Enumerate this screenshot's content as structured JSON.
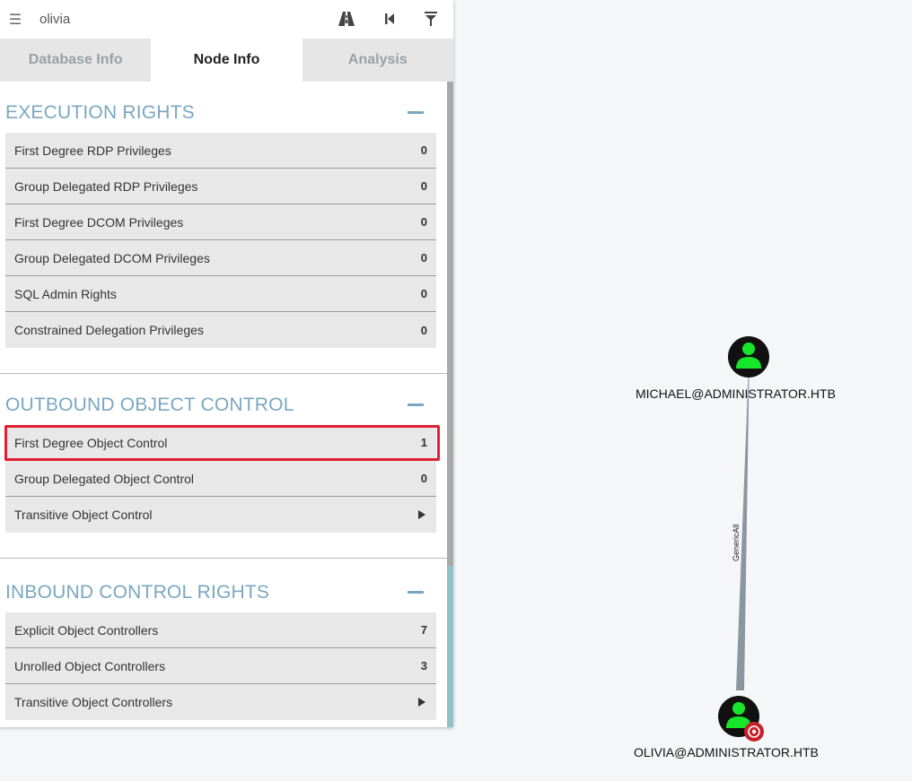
{
  "search": {
    "value": "olivia"
  },
  "toolbar_icons": [
    "pathfinding-icon",
    "back-icon",
    "filter-icon"
  ],
  "tabs": [
    {
      "label": "Database Info",
      "active": false
    },
    {
      "label": "Node Info",
      "active": true
    },
    {
      "label": "Analysis",
      "active": false
    }
  ],
  "sections": [
    {
      "title": "EXECUTION RIGHTS",
      "rows": [
        {
          "label": "First Degree RDP Privileges",
          "value": "0"
        },
        {
          "label": "Group Delegated RDP Privileges",
          "value": "0"
        },
        {
          "label": "First Degree DCOM Privileges",
          "value": "0"
        },
        {
          "label": "Group Delegated DCOM Privileges",
          "value": "0"
        },
        {
          "label": "SQL Admin Rights",
          "value": "0"
        },
        {
          "label": "Constrained Delegation Privileges",
          "value": "0"
        }
      ]
    },
    {
      "title": "OUTBOUND OBJECT CONTROL",
      "rows": [
        {
          "label": "First Degree Object Control",
          "value": "1",
          "highlighted": true
        },
        {
          "label": "Group Delegated Object Control",
          "value": "0"
        },
        {
          "label": "Transitive Object Control",
          "value": null,
          "icon": "play-arrow-icon"
        }
      ]
    },
    {
      "title": "INBOUND CONTROL RIGHTS",
      "rows": [
        {
          "label": "Explicit Object Controllers",
          "value": "7"
        },
        {
          "label": "Unrolled Object Controllers",
          "value": "3"
        },
        {
          "label": "Transitive Object Controllers",
          "value": null,
          "icon": "play-arrow-icon"
        }
      ]
    }
  ],
  "graph": {
    "nodes": [
      {
        "label": "MICHAEL@ADMINISTRATOR.HTB",
        "icon": "user-icon"
      },
      {
        "label": "OLIVIA@ADMINISTRATOR.HTB",
        "icon": "user-icon",
        "badge": "target-icon"
      }
    ],
    "edge": {
      "label": "GenericAll"
    },
    "colors": {
      "node": "#111111",
      "user": "#17e62a",
      "edge": "#8a96a0",
      "target": "#c8202a"
    }
  }
}
